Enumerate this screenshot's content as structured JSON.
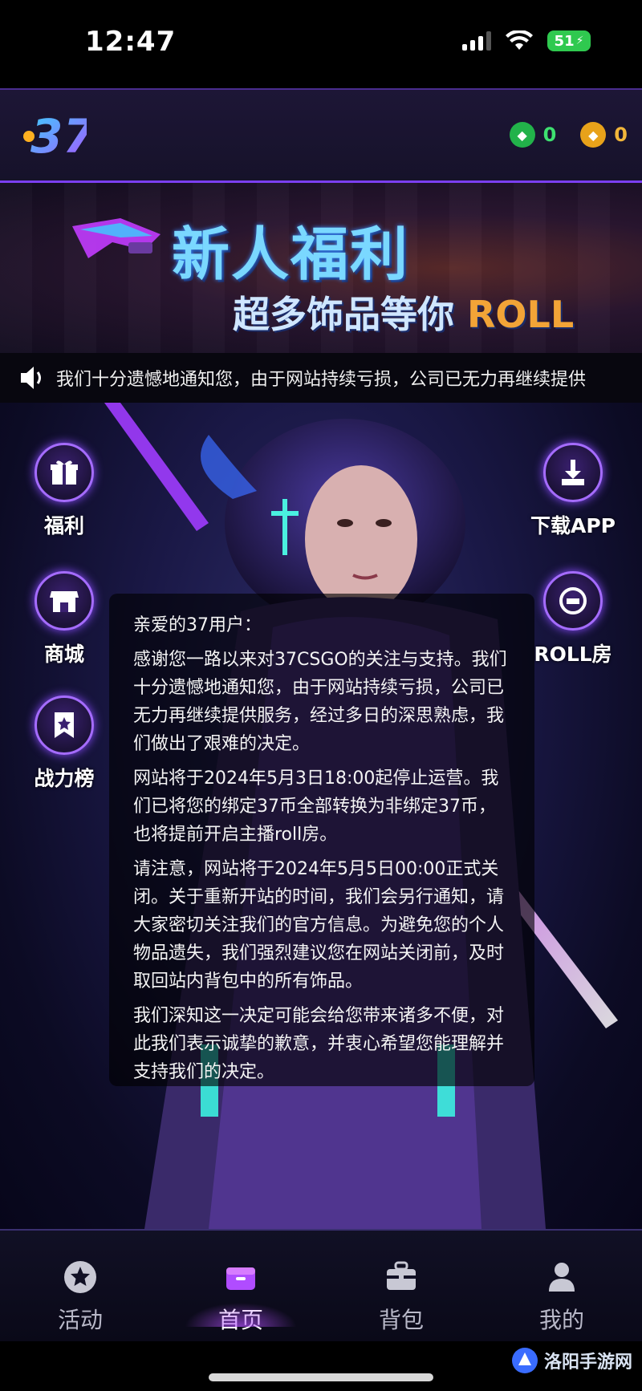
{
  "status_bar": {
    "time": "12:47",
    "battery": "51"
  },
  "header": {
    "logo": "37",
    "coins": [
      {
        "icon": "green-coin-icon",
        "value": "0",
        "color": "#22b24a"
      },
      {
        "icon": "gold-coin-icon",
        "value": "0",
        "color": "#e8a21a"
      }
    ]
  },
  "banner": {
    "title": "新人福利",
    "subtitle": "超多饰品等你",
    "subtitle_accent": "ROLL"
  },
  "marquee": {
    "text": "我们十分遗憾地通知您，由于网站持续亏损，公司已无力再继续提供"
  },
  "side_buttons": {
    "welfare": "福利",
    "shop": "商城",
    "ranking": "战力榜",
    "download": "下载APP",
    "roll_room": "ROLL房"
  },
  "notice": {
    "greeting": "亲爱的37用户：",
    "p1": "感谢您一路以来对37CSGO的关注与支持。我们十分遗憾地通知您，由于网站持续亏损，公司已无力再继续提供服务，经过多日的深思熟虑，我们做出了艰难的决定。",
    "p2": "网站将于2024年5月3日18:00起停止运营。我们已将您的绑定37币全部转换为非绑定37币，也将提前开启主播roll房。",
    "p3": "请注意，网站将于2024年5月5日00:00正式关闭。关于重新开站的时间，我们会另行通知，请大家密切关注我们的官方信息。为避免您的个人物品遗失，我们强烈建议您在网站关闭前，及时取回站内背包中的所有饰品。",
    "p4": "我们深知这一决定可能会给您带来诸多不便，对此我们表示诚挚的歉意，并衷心希望您能理解并支持我们的决定。"
  },
  "bottom_nav": [
    {
      "label": "活动",
      "icon": "star-icon",
      "active": false
    },
    {
      "label": "首页",
      "icon": "home-box-icon",
      "active": true
    },
    {
      "label": "背包",
      "icon": "backpack-icon",
      "active": false
    },
    {
      "label": "我的",
      "icon": "user-icon",
      "active": false
    }
  ],
  "watermark": "洛阳手游网",
  "colors": {
    "accent": "#8a4cff",
    "header_border": "#7b3ff0",
    "roll_orange": "#f2a437"
  }
}
